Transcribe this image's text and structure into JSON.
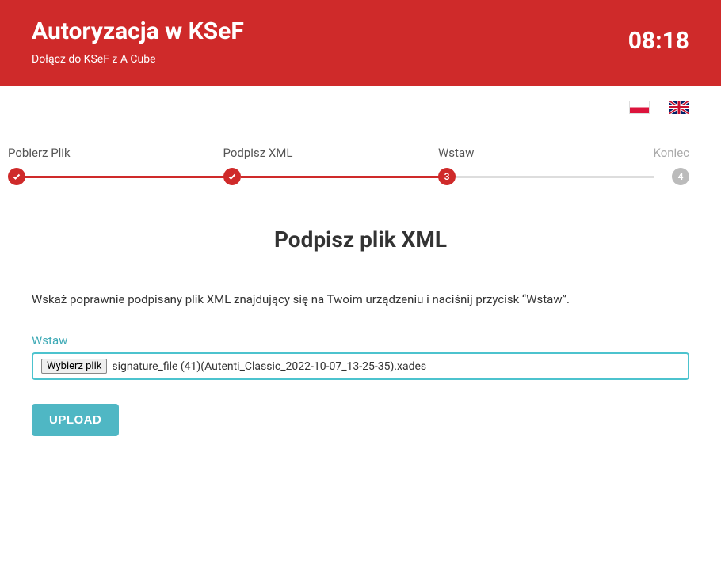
{
  "header": {
    "title": "Autoryzacja w KSeF",
    "subtitle": "Dołącz do KSeF z A Cube",
    "time": "08:18"
  },
  "steps": [
    {
      "label": "Pobierz Plik",
      "state": "done"
    },
    {
      "label": "Podpisz XML",
      "state": "done"
    },
    {
      "label": "Wstaw",
      "state": "active",
      "num": "3"
    },
    {
      "label": "Koniec",
      "state": "pending",
      "num": "4"
    }
  ],
  "main": {
    "title": "Podpisz plik XML",
    "instruction": "Wskaż poprawnie podpisany plik XML znajdujący się na Twoim urządzeniu i naciśnij przycisk “Wstaw”."
  },
  "file": {
    "field_label": "Wstaw",
    "choose_label": "Wybierz plik",
    "filename": "signature_file (41)(Autenti_Classic_2022-10-07_13-25-35).xades"
  },
  "upload": {
    "label": "UPLOAD"
  }
}
